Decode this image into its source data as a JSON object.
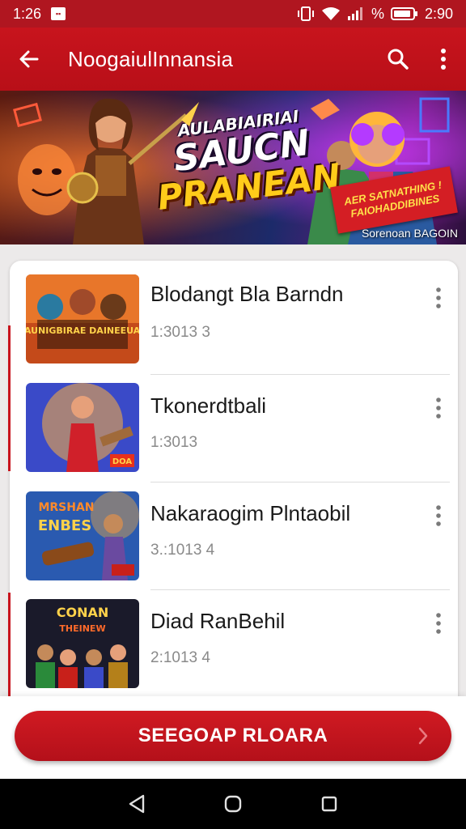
{
  "status_bar": {
    "time": "1:26",
    "notification_icon": "message-icon",
    "battery_percent_label": "%",
    "clock_right": "2:90"
  },
  "app_bar": {
    "title": "NoogaiulInnansia",
    "back_icon": "arrow-left-icon",
    "search_icon": "search-icon",
    "menu_icon": "more-vert-icon"
  },
  "banner": {
    "headline_line1": "AULABIAIRIAI",
    "headline_line2": "SAUCN",
    "headline_line3": "PRANEAN",
    "tag_line1": "AER SATNATHING !",
    "tag_line2": "FAIOHADDIBINES",
    "caption": "Sorenoan BAGOIN"
  },
  "list": {
    "items": [
      {
        "title": "Blodangt Bla Barndn",
        "meta": "1:3013 3",
        "thumb_text_top": "",
        "thumb_text_bottom": "BAUNIGBIRAE DAINEEUAN"
      },
      {
        "title": "Tkonerdtbali",
        "meta": "1:3013",
        "thumb_text_top": "",
        "thumb_text_bottom": "DOA"
      },
      {
        "title": "Nakaraogim Plntaobil",
        "meta": "3.:1013 4",
        "thumb_text_top": "MRSHAN",
        "thumb_text_bottom": "ENBES"
      },
      {
        "title": "Diad RanBehil",
        "meta": "2:1013 4",
        "thumb_text_top": "CONAN",
        "thumb_text_bottom": "THEINEW"
      }
    ]
  },
  "primary_action": {
    "label": "SEEGOAP RLOARA"
  },
  "colors": {
    "brand_red": "#c8141d",
    "status_red": "#b01620",
    "text_dark": "#1a1a1a",
    "text_muted": "#8a8a8a"
  }
}
